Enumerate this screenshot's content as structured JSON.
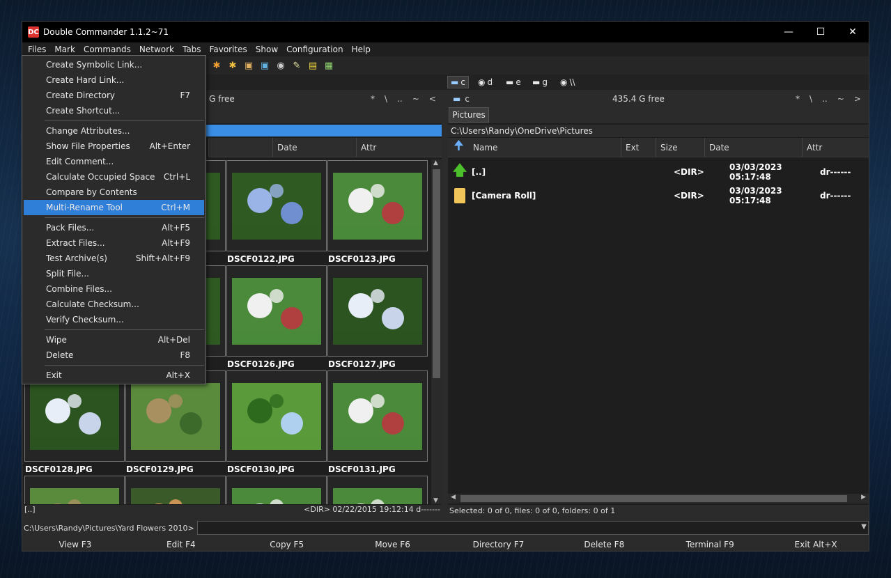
{
  "window": {
    "title": "Double Commander 1.1.2~71"
  },
  "menubar": [
    "Files",
    "Mark",
    "Commands",
    "Network",
    "Tabs",
    "Favorites",
    "Show",
    "Configuration",
    "Help"
  ],
  "files_menu": [
    {
      "label": "Create Symbolic Link...",
      "shortcut": ""
    },
    {
      "label": "Create Hard Link...",
      "shortcut": ""
    },
    {
      "label": "Create Directory",
      "shortcut": "F7"
    },
    {
      "label": "Create Shortcut...",
      "shortcut": ""
    },
    {
      "sep": true
    },
    {
      "label": "Change Attributes...",
      "shortcut": ""
    },
    {
      "label": "Show File Properties",
      "shortcut": "Alt+Enter"
    },
    {
      "label": "Edit Comment...",
      "shortcut": ""
    },
    {
      "label": "Calculate Occupied Space",
      "shortcut": "Ctrl+L"
    },
    {
      "label": "Compare by Contents",
      "shortcut": ""
    },
    {
      "label": "Multi-Rename Tool",
      "shortcut": "Ctrl+M",
      "highlighted": true
    },
    {
      "sep": true
    },
    {
      "label": "Pack Files...",
      "shortcut": "Alt+F5"
    },
    {
      "label": "Extract Files...",
      "shortcut": "Alt+F9"
    },
    {
      "label": "Test Archive(s)",
      "shortcut": "Shift+Alt+F9"
    },
    {
      "label": "Split File...",
      "shortcut": ""
    },
    {
      "label": "Combine Files...",
      "shortcut": ""
    },
    {
      "label": "Calculate Checksum...",
      "shortcut": ""
    },
    {
      "label": "Verify Checksum...",
      "shortcut": ""
    },
    {
      "sep": true
    },
    {
      "label": "Wipe",
      "shortcut": "Alt+Del"
    },
    {
      "label": "Delete",
      "shortcut": "F8"
    },
    {
      "sep": true
    },
    {
      "label": "Exit",
      "shortcut": "Alt+X"
    }
  ],
  "drives": [
    {
      "letter": "c",
      "active": true
    },
    {
      "letter": "d"
    },
    {
      "letter": "e"
    },
    {
      "letter": "g"
    },
    {
      "letter": "\\\\"
    }
  ],
  "left_panel": {
    "free": "G free",
    "nav": [
      "*",
      "\\",
      "..",
      "~",
      "<"
    ],
    "columns": [
      "Date",
      "Attr"
    ],
    "thumbnails": [
      {
        "name": "",
        "theme": "hydrangea"
      },
      {
        "name": "",
        "theme": "hydrangea"
      },
      {
        "name": "DSCF0122.JPG",
        "theme": "hydrangea"
      },
      {
        "name": "DSCF0123.JPG",
        "theme": "house"
      },
      {
        "name": "",
        "theme": "hydrangea"
      },
      {
        "name": "",
        "theme": "hydrangea"
      },
      {
        "name": "DSCF0126.JPG",
        "theme": "house"
      },
      {
        "name": "DSCF0127.JPG",
        "theme": "hydrangea-white"
      },
      {
        "name": "DSCF0128.JPG",
        "theme": "hydrangea-white"
      },
      {
        "name": "DSCF0129.JPG",
        "theme": "garden"
      },
      {
        "name": "DSCF0130.JPG",
        "theme": "tree"
      },
      {
        "name": "DSCF0131.JPG",
        "theme": "house"
      },
      {
        "name": "",
        "theme": "garden"
      },
      {
        "name": "",
        "theme": "lily"
      },
      {
        "name": "",
        "theme": "house"
      },
      {
        "name": "",
        "theme": "house"
      }
    ],
    "status_left": "[..]",
    "status_right": "<DIR>  02/22/2015 19:12:14  d-------"
  },
  "right_panel": {
    "drive": "c",
    "free": "435.4 G free",
    "nav": [
      "*",
      "\\",
      "..",
      "~",
      ">"
    ],
    "tab": "Pictures",
    "path": "C:\\Users\\Randy\\OneDrive\\Pictures",
    "columns": [
      "Name",
      "Ext",
      "Size",
      "Date",
      "Attr"
    ],
    "rows": [
      {
        "name": "[..]",
        "size": "<DIR>",
        "date": "03/03/2023 05:17:48",
        "attr": "dr------",
        "icon": "up-arrow"
      },
      {
        "name": "[Camera Roll]",
        "size": "<DIR>",
        "date": "03/03/2023 05:17:48",
        "attr": "dr------",
        "icon": "folder"
      }
    ],
    "status": "Selected: 0 of 0, files: 0 of 0, folders: 0 of 1"
  },
  "cmdline": {
    "path": "C:\\Users\\Randy\\Pictures\\Yard Flowers 2010>"
  },
  "fkeys": [
    "View F3",
    "Edit F4",
    "Copy F5",
    "Move F6",
    "Directory F7",
    "Delete F8",
    "Terminal F9",
    "Exit Alt+X"
  ]
}
